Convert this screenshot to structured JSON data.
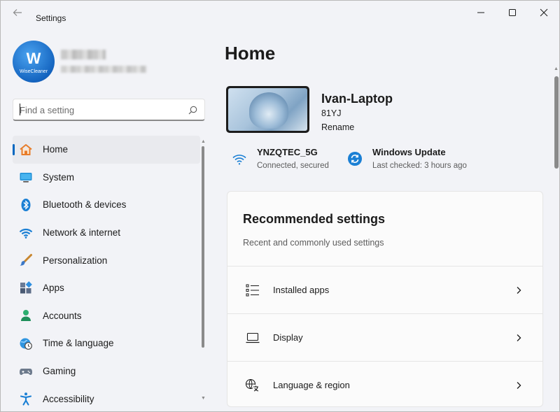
{
  "window": {
    "title": "Settings"
  },
  "search": {
    "placeholder": "Find a setting"
  },
  "nav": {
    "items": [
      {
        "label": "Home",
        "icon": "home-icon",
        "active": true
      },
      {
        "label": "System",
        "icon": "system-icon"
      },
      {
        "label": "Bluetooth & devices",
        "icon": "bluetooth-icon"
      },
      {
        "label": "Network & internet",
        "icon": "wifi-icon"
      },
      {
        "label": "Personalization",
        "icon": "brush-icon"
      },
      {
        "label": "Apps",
        "icon": "apps-icon"
      },
      {
        "label": "Accounts",
        "icon": "accounts-icon"
      },
      {
        "label": "Time & language",
        "icon": "clock-globe-icon"
      },
      {
        "label": "Gaming",
        "icon": "gamepad-icon"
      },
      {
        "label": "Accessibility",
        "icon": "accessibility-icon"
      }
    ]
  },
  "main": {
    "title": "Home",
    "device": {
      "name": "Ivan-Laptop",
      "model": "81YJ",
      "rename": "Rename"
    },
    "network": {
      "name": "YNZQTEC_5G",
      "status": "Connected, secured"
    },
    "update": {
      "title": "Windows Update",
      "status": "Last checked: 3 hours ago"
    },
    "recommended": {
      "title": "Recommended settings",
      "subtitle": "Recent and commonly used settings",
      "items": [
        {
          "label": "Installed apps",
          "icon": "installed-apps-icon"
        },
        {
          "label": "Display",
          "icon": "display-icon"
        },
        {
          "label": "Language & region",
          "icon": "language-icon"
        }
      ]
    }
  },
  "profile": {
    "logo_letter": "W",
    "logo_text": "WiseCleaner"
  },
  "colors": {
    "accent": "#0067c0",
    "window_bg": "#f2f3f7"
  }
}
